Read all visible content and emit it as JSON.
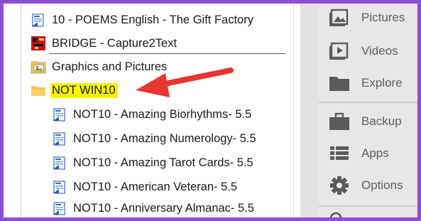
{
  "tree": {
    "items": [
      {
        "label": "10 - POEMS English - The Gift Factory",
        "icon": "app-document-icon"
      },
      {
        "label": "BRIDGE - Capture2Text",
        "icon": "capture-app-icon"
      },
      {
        "label": "Graphics and Pictures",
        "icon": "pictures-folder-icon"
      },
      {
        "label": "NOT WIN10",
        "icon": "folder-icon",
        "highlighted": true
      },
      {
        "label": "NOT10 - Amazing Biorhythms- 5.5",
        "icon": "app-document-icon"
      },
      {
        "label": "NOT10 - Amazing Numerology- 5.5",
        "icon": "app-document-icon"
      },
      {
        "label": "NOT10 - Amazing Tarot Cards- 5.5",
        "icon": "app-document-icon"
      },
      {
        "label": "NOT10 - American Veteran- 5.5",
        "icon": "app-document-icon"
      },
      {
        "label": "NOT10 - Anniversary Almanac- 5.5",
        "icon": "app-document-icon"
      }
    ],
    "highlight_color": "#f7f300",
    "arrow_color": "#e8352f"
  },
  "side": {
    "items": [
      {
        "label": "Pictures",
        "icon": "pictures-icon"
      },
      {
        "label": "Videos",
        "icon": "videos-icon"
      },
      {
        "label": "Explore",
        "icon": "folder-icon"
      },
      {
        "label": "Backup",
        "icon": "briefcase-icon"
      },
      {
        "label": "Apps",
        "icon": "list-icon"
      },
      {
        "label": "Options",
        "icon": "gear-icon"
      }
    ]
  },
  "colors": {
    "frame_border": "#8c4fd0",
    "sidebar_bg": "#e7e7e7",
    "sidebar_icon": "#5b5b5b"
  }
}
